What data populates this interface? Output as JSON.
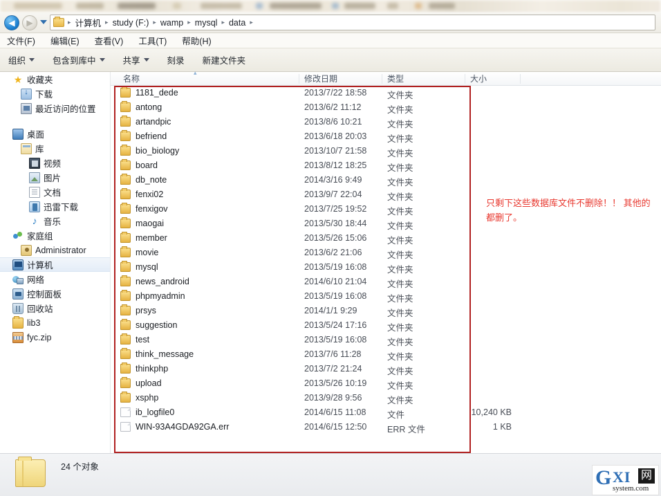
{
  "window": {
    "nav": {
      "back_label": "◀",
      "forward_label": "▶",
      "dropdown_label": "recent-locations"
    },
    "breadcrumb": {
      "folder_icon": "folder-icon",
      "items": [
        "计算机",
        "study (F:)",
        "wamp",
        "mysql",
        "data"
      ],
      "separator": "▸"
    },
    "menu": [
      {
        "label": "文件(F)"
      },
      {
        "label": "编辑(E)"
      },
      {
        "label": "查看(V)"
      },
      {
        "label": "工具(T)"
      },
      {
        "label": "帮助(H)"
      }
    ],
    "toolbar": [
      {
        "label": "组织",
        "caret": true
      },
      {
        "label": "包含到库中",
        "caret": true
      },
      {
        "label": "共享",
        "caret": true
      },
      {
        "label": "刻录",
        "caret": false
      },
      {
        "label": "新建文件夹",
        "caret": false
      }
    ]
  },
  "sidebar": {
    "items": [
      {
        "label": "收藏夹",
        "icon": "star-icon",
        "indent": 0,
        "selected": false
      },
      {
        "label": "下载",
        "icon": "download-icon",
        "indent": 1,
        "selected": false
      },
      {
        "label": "最近访问的位置",
        "icon": "recent-icon",
        "indent": 1,
        "selected": false
      },
      {
        "label": "桌面",
        "icon": "desktop-icon",
        "indent": 0,
        "selected": false
      },
      {
        "label": "库",
        "icon": "library-icon",
        "indent": 1,
        "selected": false
      },
      {
        "label": "视频",
        "icon": "video-icon",
        "indent": 2,
        "selected": false
      },
      {
        "label": "图片",
        "icon": "picture-icon",
        "indent": 2,
        "selected": false
      },
      {
        "label": "文档",
        "icon": "document-icon",
        "indent": 2,
        "selected": false
      },
      {
        "label": "迅雷下载",
        "icon": "thunder-icon",
        "indent": 2,
        "selected": false
      },
      {
        "label": "音乐",
        "icon": "music-icon",
        "indent": 2,
        "selected": false
      },
      {
        "label": "家庭组",
        "icon": "homegroup-icon",
        "indent": 0,
        "selected": false
      },
      {
        "label": "Administrator",
        "icon": "user-icon",
        "indent": 1,
        "selected": false
      },
      {
        "label": "计算机",
        "icon": "computer-icon",
        "indent": 0,
        "selected": true
      },
      {
        "label": "网络",
        "icon": "network-icon",
        "indent": 0,
        "selected": false
      },
      {
        "label": "控制面板",
        "icon": "control-panel-icon",
        "indent": 0,
        "selected": false
      },
      {
        "label": "回收站",
        "icon": "recycle-bin-icon",
        "indent": 0,
        "selected": false
      },
      {
        "label": "lib3",
        "icon": "folder-icon",
        "indent": 0,
        "selected": false
      },
      {
        "label": "fyc.zip",
        "icon": "zip-icon",
        "indent": 0,
        "selected": false
      }
    ]
  },
  "filelist": {
    "columns": [
      {
        "key": "name",
        "label": "名称"
      },
      {
        "key": "date",
        "label": "修改日期"
      },
      {
        "key": "type",
        "label": "类型"
      },
      {
        "key": "size",
        "label": "大小"
      }
    ],
    "sorted_column": "名称",
    "sort_direction": "ascending",
    "rows": [
      {
        "name": "1181_dede",
        "date": "2013/7/22 18:58",
        "type": "文件夹",
        "size": "",
        "icon": "folder-icon"
      },
      {
        "name": "antong",
        "date": "2013/6/2 11:12",
        "type": "文件夹",
        "size": "",
        "icon": "folder-icon"
      },
      {
        "name": "artandpic",
        "date": "2013/8/6 10:21",
        "type": "文件夹",
        "size": "",
        "icon": "folder-icon"
      },
      {
        "name": "befriend",
        "date": "2013/6/18 20:03",
        "type": "文件夹",
        "size": "",
        "icon": "folder-icon"
      },
      {
        "name": "bio_biology",
        "date": "2013/10/7 21:58",
        "type": "文件夹",
        "size": "",
        "icon": "folder-icon"
      },
      {
        "name": "board",
        "date": "2013/8/12 18:25",
        "type": "文件夹",
        "size": "",
        "icon": "folder-icon"
      },
      {
        "name": "db_note",
        "date": "2014/3/16 9:49",
        "type": "文件夹",
        "size": "",
        "icon": "folder-icon"
      },
      {
        "name": "fenxi02",
        "date": "2013/9/7 22:04",
        "type": "文件夹",
        "size": "",
        "icon": "folder-icon"
      },
      {
        "name": "fenxigov",
        "date": "2013/7/25 19:52",
        "type": "文件夹",
        "size": "",
        "icon": "folder-icon"
      },
      {
        "name": "maogai",
        "date": "2013/5/30 18:44",
        "type": "文件夹",
        "size": "",
        "icon": "folder-icon"
      },
      {
        "name": "member",
        "date": "2013/5/26 15:06",
        "type": "文件夹",
        "size": "",
        "icon": "folder-icon"
      },
      {
        "name": "movie",
        "date": "2013/6/2 21:06",
        "type": "文件夹",
        "size": "",
        "icon": "folder-icon"
      },
      {
        "name": "mysql",
        "date": "2013/5/19 16:08",
        "type": "文件夹",
        "size": "",
        "icon": "folder-icon"
      },
      {
        "name": "news_android",
        "date": "2014/6/10 21:04",
        "type": "文件夹",
        "size": "",
        "icon": "folder-icon"
      },
      {
        "name": "phpmyadmin",
        "date": "2013/5/19 16:08",
        "type": "文件夹",
        "size": "",
        "icon": "folder-icon"
      },
      {
        "name": "prsys",
        "date": "2014/1/1 9:29",
        "type": "文件夹",
        "size": "",
        "icon": "folder-icon"
      },
      {
        "name": "suggestion",
        "date": "2013/5/24 17:16",
        "type": "文件夹",
        "size": "",
        "icon": "folder-icon"
      },
      {
        "name": "test",
        "date": "2013/5/19 16:08",
        "type": "文件夹",
        "size": "",
        "icon": "folder-icon"
      },
      {
        "name": "think_message",
        "date": "2013/7/6 11:28",
        "type": "文件夹",
        "size": "",
        "icon": "folder-icon"
      },
      {
        "name": "thinkphp",
        "date": "2013/7/2 21:24",
        "type": "文件夹",
        "size": "",
        "icon": "folder-icon"
      },
      {
        "name": "upload",
        "date": "2013/5/26 10:19",
        "type": "文件夹",
        "size": "",
        "icon": "folder-icon"
      },
      {
        "name": "xsphp",
        "date": "2013/9/28 9:56",
        "type": "文件夹",
        "size": "",
        "icon": "folder-icon"
      },
      {
        "name": "ib_logfile0",
        "date": "2014/6/15 11:08",
        "type": "文件",
        "size": "10,240 KB",
        "icon": "file-icon"
      },
      {
        "name": "WIN-93A4GDA92GA.err",
        "date": "2014/6/15 12:50",
        "type": "ERR 文件",
        "size": "1 KB",
        "icon": "file-icon"
      }
    ]
  },
  "annotation": {
    "text": "只剩下这些数据库文件不删除！！ 其他的都删了。",
    "color": "#e8382f",
    "box_color": "#b02020"
  },
  "statusbar": {
    "folder_icon": "folder-icon",
    "item_count_text": "24 个对象"
  },
  "watermark": {
    "letter_g": "G",
    "letters_xi": "XI",
    "char_net": "网",
    "domain": "system.com"
  }
}
